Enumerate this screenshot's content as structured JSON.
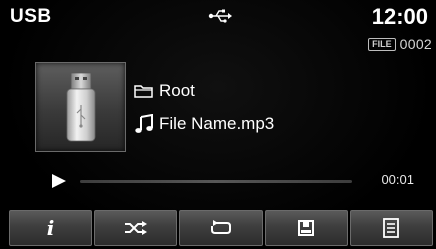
{
  "status": {
    "source": "USB",
    "clock": "12:00",
    "file_tag": "FILE",
    "file_number": "0002"
  },
  "track": {
    "folder": "Root",
    "file_name": "File Name.mp3"
  },
  "playback": {
    "elapsed": "00:01",
    "progress": 0.0
  },
  "buttons": [
    {
      "name": "info",
      "icon": "info-icon"
    },
    {
      "name": "shuffle",
      "icon": "shuffle-icon"
    },
    {
      "name": "repeat",
      "icon": "repeat-icon"
    },
    {
      "name": "copy",
      "icon": "save-icon"
    },
    {
      "name": "list",
      "icon": "list-icon"
    }
  ],
  "colors": {
    "background": "#000000",
    "text": "#ffffff",
    "button": "#3e3e3e"
  }
}
